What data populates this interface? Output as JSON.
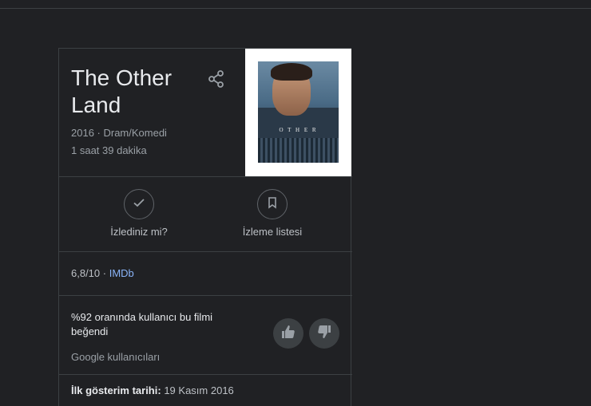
{
  "movie": {
    "title": "The Other Land",
    "year_genre": "2016 · Dram/Komedi",
    "duration": "1 saat 39 dakika",
    "poster_text": "O T H E R"
  },
  "actions": {
    "watched_label": "İzlediniz mi?",
    "watchlist_label": "İzleme listesi"
  },
  "rating": {
    "score": "6,8/10 ·",
    "source": "IMDb"
  },
  "audience": {
    "liked_text": "%92 oranında kullanıcı bu filmi beğendi",
    "source": "Google kullanıcıları"
  },
  "release": {
    "label": "İlk gösterim tarihi:",
    "value": "19 Kasım 2016"
  },
  "colors": {
    "background": "#202124",
    "divider": "#3c4043",
    "link": "#8ab4f8"
  },
  "icons": [
    "share-icon",
    "checkmark-icon",
    "bookmark-icon",
    "thumbs-up-icon",
    "thumbs-down-icon"
  ]
}
